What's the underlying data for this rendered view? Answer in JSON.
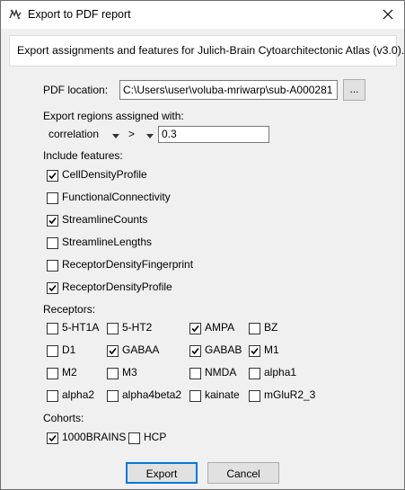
{
  "title": "Export to PDF report",
  "header_text": "Export assignments and features for Julich-Brain Cytoarchitectonic Atlas (v3.0).",
  "pdf_location": {
    "label": "PDF location:",
    "value": "C:\\Users\\user\\voluba-mriwarp\\sub-A000281",
    "browse": "..."
  },
  "export_regions": {
    "label": "Export regions assigned with:",
    "metric": "correlation",
    "operator": ">",
    "threshold": "0.3"
  },
  "features": {
    "label": "Include features:",
    "items": [
      {
        "label": "CellDensityProfile",
        "checked": true
      },
      {
        "label": "FunctionalConnectivity",
        "checked": false
      },
      {
        "label": "StreamlineCounts",
        "checked": true
      },
      {
        "label": "StreamlineLengths",
        "checked": false
      },
      {
        "label": "ReceptorDensityFingerprint",
        "checked": false
      },
      {
        "label": "ReceptorDensityProfile",
        "checked": true
      }
    ]
  },
  "receptors": {
    "label": "Receptors:",
    "items": [
      {
        "label": "5-HT1A",
        "checked": false
      },
      {
        "label": "5-HT2",
        "checked": false
      },
      {
        "label": "AMPA",
        "checked": true
      },
      {
        "label": "BZ",
        "checked": false
      },
      {
        "label": "D1",
        "checked": false
      },
      {
        "label": "GABAA",
        "checked": true
      },
      {
        "label": "GABAB",
        "checked": true
      },
      {
        "label": "M1",
        "checked": true
      },
      {
        "label": "M2",
        "checked": false
      },
      {
        "label": "M3",
        "checked": false
      },
      {
        "label": "NMDA",
        "checked": false
      },
      {
        "label": "alpha1",
        "checked": false
      },
      {
        "label": "alpha2",
        "checked": false
      },
      {
        "label": "alpha4beta2",
        "checked": false
      },
      {
        "label": "kainate",
        "checked": false
      },
      {
        "label": "mGluR2_3",
        "checked": false
      }
    ]
  },
  "cohorts": {
    "label": "Cohorts:",
    "items": [
      {
        "label": "1000BRAINS",
        "checked": true
      },
      {
        "label": "HCP",
        "checked": false
      }
    ]
  },
  "buttons": {
    "export": "Export",
    "cancel": "Cancel"
  }
}
